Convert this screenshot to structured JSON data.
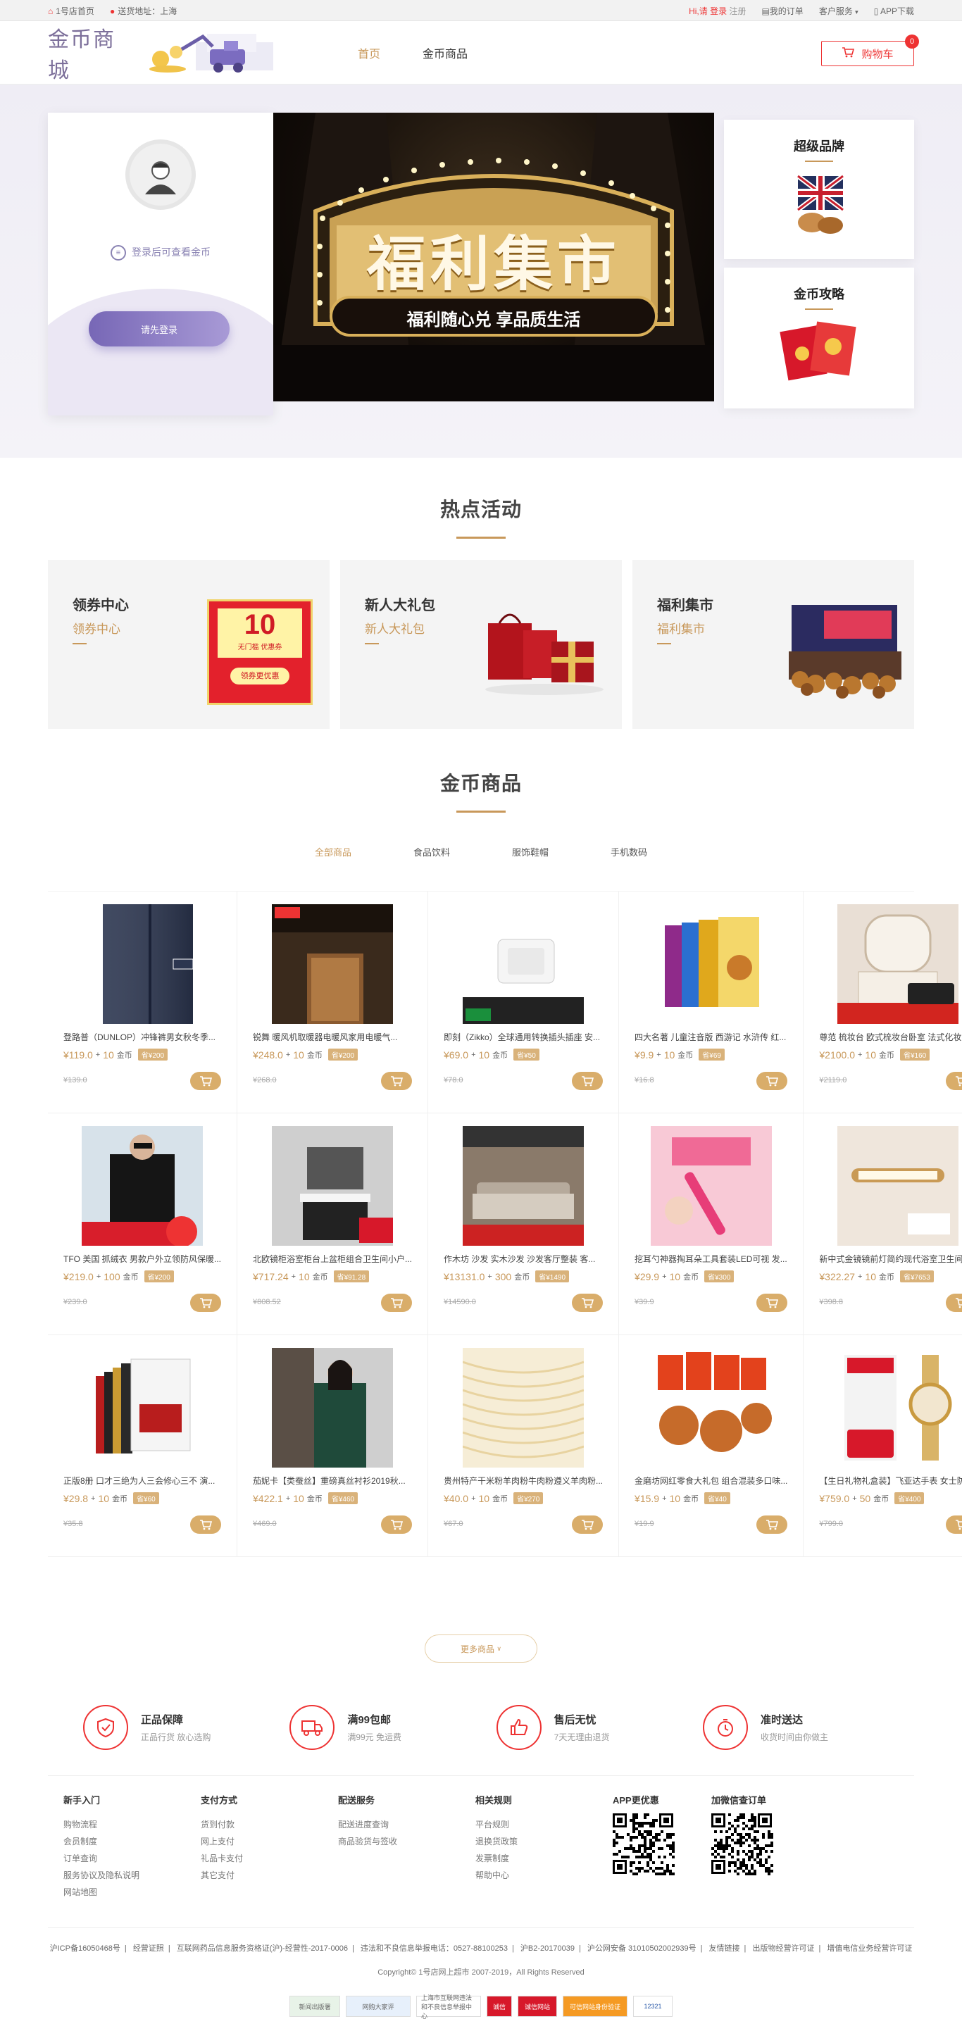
{
  "topbar": {
    "home": "1号店首页",
    "location_label": "送货地址：",
    "location_value": "上海",
    "greeting": "Hi,请 登录",
    "register": "注册",
    "orders": "我的订单",
    "service": "客户服务",
    "app": "APP下载"
  },
  "header": {
    "logo": "金币商城",
    "nav": [
      "首页",
      "金币商品"
    ],
    "cart": "购物车",
    "cart_count": "0"
  },
  "banner": {
    "login_tip": "登录后可查看金币",
    "login_button": "请先登录",
    "hero_title": "福利集市",
    "hero_sub": "福利随心兑  享品质生活",
    "side_cards": [
      "超级品牌",
      "金币攻略"
    ]
  },
  "hot": {
    "title": "热点活动",
    "items": [
      {
        "title": "领券中心",
        "sub": "领券中心",
        "coupon_value": "10",
        "coupon_text": "无门槛 优惠券",
        "coupon_btn": "领券更优惠"
      },
      {
        "title": "新人大礼包",
        "sub": "新人大礼包"
      },
      {
        "title": "福利集市",
        "sub": "福利集市"
      }
    ]
  },
  "goods": {
    "title": "金币商品",
    "categories": [
      "全部商品",
      "食品饮料",
      "服饰鞋帽",
      "手机数码"
    ],
    "products": [
      {
        "name": "登路普（DUNLOP）冲锋裤男女秋冬季...",
        "price": "¥119.0",
        "coins": "10",
        "saving": "省¥200",
        "orig": "¥139.0"
      },
      {
        "name": "锐舞 暖风机取暖器电暖风家用电暖气...",
        "price": "¥248.0",
        "coins": "10",
        "saving": "省¥200",
        "orig": "¥268.0"
      },
      {
        "name": "即刻（Zikko）全球通用转换插头插座 安...",
        "price": "¥69.0",
        "coins": "10",
        "saving": "省¥50",
        "orig": "¥78.0"
      },
      {
        "name": "四大名著 儿童注音版 西游记 水浒传 红...",
        "price": "¥9.9",
        "coins": "10",
        "saving": "省¥69",
        "orig": "¥16.8"
      },
      {
        "name": "尊范 梳妆台 欧式梳妆台卧室 法式化妆台...",
        "price": "¥2100.0",
        "coins": "10",
        "saving": "省¥160",
        "orig": "¥2119.0"
      },
      {
        "name": "TFO 美国 抓绒衣 男款户外立领防风保暖...",
        "price": "¥219.0",
        "coins": "100",
        "saving": "省¥200",
        "orig": "¥239.0"
      },
      {
        "name": "北欧镜柜浴室柜台上盆柜组合卫生间小户...",
        "price": "¥717.24",
        "coins": "10",
        "saving": "省¥91.28",
        "orig": "¥808.52"
      },
      {
        "name": "作木坊 沙发 实木沙发 沙发客厅整装 客...",
        "price": "¥13131.0",
        "coins": "300",
        "saving": "省¥1490",
        "orig": "¥14590.0"
      },
      {
        "name": "挖耳勺神器掏耳朵工具套装LED可视 发...",
        "price": "¥29.9",
        "coins": "10",
        "saving": "省¥300",
        "orig": "¥39.9"
      },
      {
        "name": "新中式金镜镜前灯简约现代浴室卫生间...",
        "price": "¥322.27",
        "coins": "10",
        "saving": "省¥7653",
        "orig": "¥398.8"
      },
      {
        "name": "正版8册 口才三绝为人三会修心三不 演...",
        "price": "¥29.8",
        "coins": "10",
        "saving": "省¥60",
        "orig": "¥35.8"
      },
      {
        "name": "茄妮卡【类蚕丝】重磅真丝衬衫2019秋...",
        "price": "¥422.1",
        "coins": "10",
        "saving": "省¥460",
        "orig": "¥469.0"
      },
      {
        "name": "贵州特产干米粉羊肉粉牛肉粉遵义羊肉粉...",
        "price": "¥40.0",
        "coins": "10",
        "saving": "省¥270",
        "orig": "¥67.0"
      },
      {
        "name": "金磨坊网红零食大礼包 组合混装多口味...",
        "price": "¥15.9",
        "coins": "10",
        "saving": "省¥40",
        "orig": "¥19.9"
      },
      {
        "name": "【生日礼物礼盒装】飞亚达手表 女士防...",
        "price": "¥759.0",
        "coins": "50",
        "saving": "省¥400",
        "orig": "¥799.0"
      }
    ],
    "coins_unit": "金币",
    "plus": "+",
    "more": "更多商品"
  },
  "guarantees": [
    {
      "title": "正品保障",
      "sub": "正品行货 放心选购"
    },
    {
      "title": "满99包邮",
      "sub": "满99元 免运费"
    },
    {
      "title": "售后无忧",
      "sub": "7天无理由退货"
    },
    {
      "title": "准时送达",
      "sub": "收货时间由你做主"
    }
  ],
  "footer": {
    "columns": [
      {
        "title": "新手入门",
        "links": [
          "购物流程",
          "会员制度",
          "订单查询",
          "服务协议及隐私说明",
          "网站地图"
        ]
      },
      {
        "title": "支付方式",
        "links": [
          "货到付款",
          "网上支付",
          "礼品卡支付",
          "其它支付"
        ]
      },
      {
        "title": "配送服务",
        "links": [
          "配送进度查询",
          "商品验货与签收"
        ]
      },
      {
        "title": "相关规则",
        "links": [
          "平台规则",
          "退换货政策",
          "发票制度",
          "帮助中心"
        ]
      }
    ],
    "qr_titles": [
      "APP更优惠",
      "加微信查订单"
    ],
    "license": [
      "沪ICP备16050468号",
      "经营证照",
      "互联网药品信息服务资格证(沪)-经营性-2017-0006",
      "违法和不良信息举报电话：0527-88100253",
      "沪B2-20170039",
      "沪公网安备 31010502002939号",
      "友情链接",
      "出版物经营许可证",
      "增值电信业务经营许可证"
    ],
    "copyright": "Copyright© 1号店网上超市 2007-2019，All Rights Reserved",
    "badges": [
      "新闻出版署",
      "网购大家评",
      "上海市互联网违法和不良信息举报中心",
      "诚信",
      "诚信网站",
      "可信网站身份验证",
      "12321"
    ]
  }
}
